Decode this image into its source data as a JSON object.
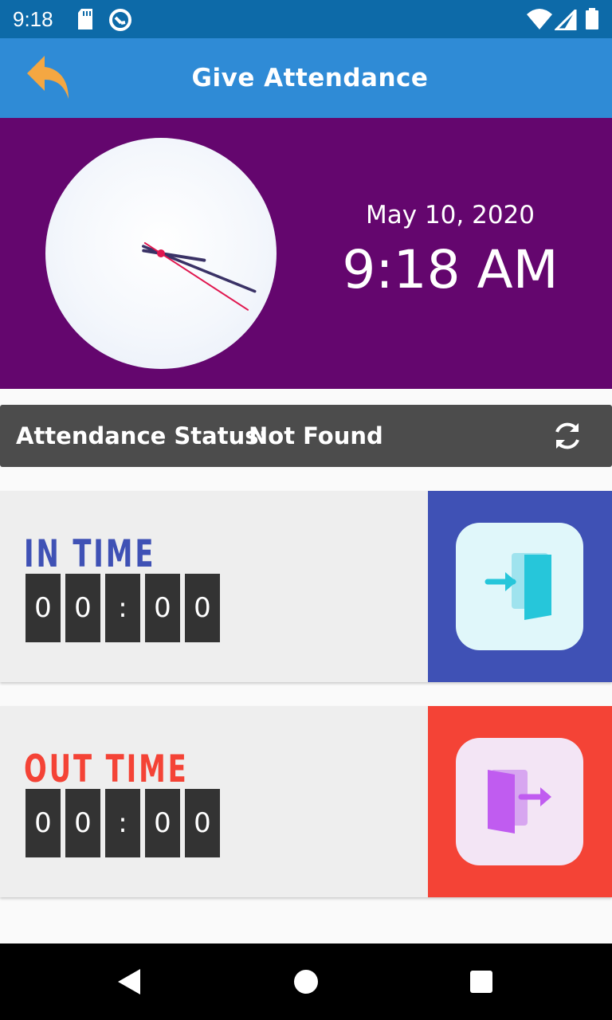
{
  "status_bar": {
    "time": "9:18",
    "icons": [
      "sd-card-icon",
      "sync-badge-icon",
      "wifi-icon",
      "signal-icon",
      "battery-icon"
    ]
  },
  "app_bar": {
    "title": "Give Attendance",
    "back_icon": "reply-arrow-icon"
  },
  "clock": {
    "date": "May 10, 2020",
    "time": "9:18 AM",
    "hour": 9,
    "minute": 18,
    "second": 20
  },
  "attendance": {
    "label": "Attendance Status:",
    "value": "Not Found",
    "refresh_icon": "refresh-icon"
  },
  "in_card": {
    "title": "IN TIME",
    "digits": [
      "0",
      "0",
      ":",
      "0",
      "0"
    ],
    "action_icon": "enter-door-icon"
  },
  "out_card": {
    "title": "OUT TIME",
    "digits": [
      "0",
      "0",
      ":",
      "0",
      "0"
    ],
    "action_icon": "exit-door-icon"
  },
  "nav": {
    "items": [
      "back-triangle-icon",
      "home-circle-icon",
      "recents-square-icon"
    ]
  },
  "colors": {
    "status_bar": "#0d6aa8",
    "app_bar": "#2f8bd6",
    "clock_panel": "#64066e",
    "status_strip": "#4c4c4c",
    "in_accent": "#3f51b5",
    "out_accent": "#f44336",
    "back_icon": "#f4a742"
  }
}
